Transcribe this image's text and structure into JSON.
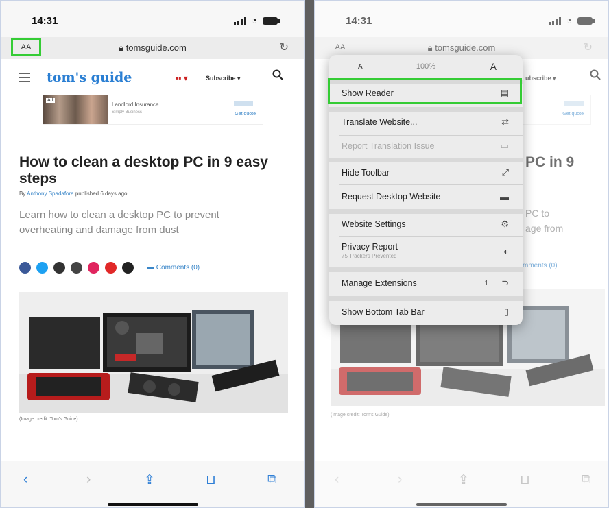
{
  "status": {
    "time": "14:31"
  },
  "browser": {
    "aa_label": "AA",
    "url": "tomsguide.com"
  },
  "site": {
    "logo": "tom's guide",
    "flag": "▪▪ ▾",
    "subscribe": "Subscribe ▾"
  },
  "ad": {
    "tag": "Ad",
    "title": "Landlord Insurance",
    "subtitle": "Simply Business",
    "cta": "Get quote"
  },
  "article": {
    "title": "How to clean a desktop PC in 9 easy steps",
    "by_prefix": "By ",
    "author": "Anthony Spadafora",
    "by_suffix": " published 6 days ago",
    "summary": "Learn how to clean a desktop PC to prevent overheating and damage from dust",
    "comments": "Comments (0)",
    "caption": "(Image credit: Tom's Guide)"
  },
  "right_page": {
    "subscribe_partial": "ubscribe ▾",
    "title_partial": "PC in 9",
    "summary_partial_1": "PC to",
    "summary_partial_2": "age from",
    "comments_partial": "mments (0)"
  },
  "menu": {
    "zoom_small": "A",
    "zoom_percent": "100%",
    "zoom_large": "A",
    "items": [
      {
        "label": "Show Reader",
        "icon": "▤"
      },
      {
        "label": "Translate Website...",
        "icon": "⇄"
      },
      {
        "label": "Report Translation Issue",
        "icon": "▭"
      },
      {
        "label": "Hide Toolbar",
        "icon": "⤢"
      },
      {
        "label": "Request Desktop Website",
        "icon": "▬"
      },
      {
        "label": "Website Settings",
        "icon": "⚙"
      },
      {
        "label": "Privacy Report",
        "icon": "◐",
        "sub": "75 Trackers Prevented"
      },
      {
        "label": "Manage Extensions",
        "icon": "⊃",
        "badge": "1"
      },
      {
        "label": "Show Bottom Tab Bar",
        "icon": "▯"
      }
    ]
  },
  "colors": {
    "accent": "#2f7fd6",
    "highlight": "#35cc35",
    "logo": "#2b7fd3"
  }
}
